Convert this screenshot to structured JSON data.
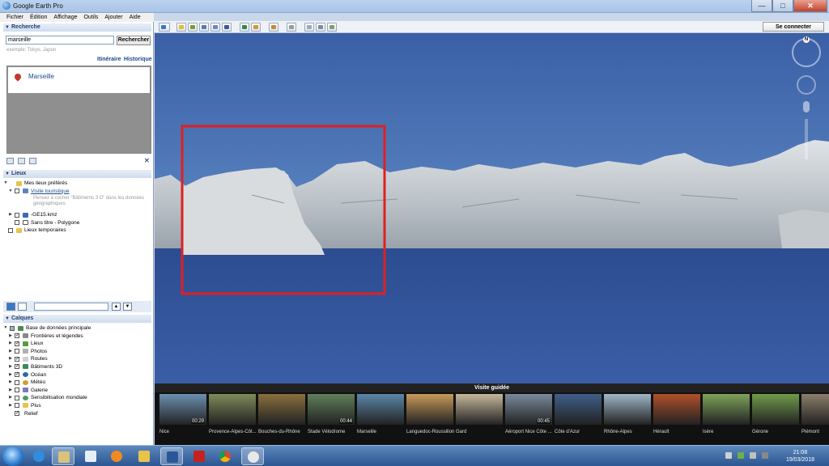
{
  "window": {
    "title": "Google Earth Pro",
    "minimize": "—",
    "maximize": "□",
    "close": "✕",
    "accent": "#2b6cb4"
  },
  "menu": [
    "Fichier",
    "Édition",
    "Affichage",
    "Outils",
    "Ajouter",
    "Aide"
  ],
  "toolbar": {
    "icons": [
      "sidebar-icon",
      "placemark-icon",
      "polygon-icon",
      "path-icon",
      "overlay-icon",
      "record-tour-icon",
      "historical-imagery-icon",
      "sun-icon",
      "planets-icon",
      "ruler-icon",
      "email-icon",
      "print-icon",
      "save-image-icon"
    ],
    "signin_label": "Se connecter"
  },
  "search": {
    "header": "Recherche",
    "input_value": "marseille",
    "button": "Rechercher",
    "hint": "exemple: Tokyo, Japon",
    "links": [
      "Itinéraire",
      "Historique"
    ],
    "results": [
      "Marseille"
    ]
  },
  "places": {
    "header": "Lieux",
    "items": [
      {
        "label": "Mes lieux préférés",
        "icon": "folder-icon"
      },
      {
        "label": "Visite touristique",
        "icon": "folder-icon",
        "description": "Pensez à cocher \"Bâtiments 3 D\" dans les données géographiques"
      },
      {
        "label": "-GE15.kmz",
        "icon": "kmz-icon"
      },
      {
        "label": "Sans titre - Polygone",
        "icon": "polygon-icon"
      },
      {
        "label": "Lieux temporaires",
        "icon": "folder-icon"
      }
    ]
  },
  "layers": {
    "header": "Calques",
    "root": "Base de données principale",
    "items": [
      {
        "label": "Frontières et légendes",
        "checked": true
      },
      {
        "label": "Lieux",
        "checked": true
      },
      {
        "label": "Photos",
        "checked": false
      },
      {
        "label": "Routes",
        "checked": true
      },
      {
        "label": "Bâtiments 3D",
        "checked": true
      },
      {
        "label": "Océan",
        "checked": true
      },
      {
        "label": "Météo",
        "checked": false
      },
      {
        "label": "Galerie",
        "checked": false
      },
      {
        "label": "Sensibilisation mondiale",
        "checked": false
      },
      {
        "label": "Plus",
        "checked": false
      },
      {
        "label": "Relief",
        "checked": true
      }
    ]
  },
  "map": {
    "sea_color": "#2e4f93",
    "sky_color": "#3c63ab",
    "highlight_color": "#e02020",
    "nav_north": "N"
  },
  "tour": {
    "header": "Visite guidée",
    "items": [
      {
        "label": "Nice",
        "duration": "00:29",
        "color": "#6d8fb0"
      },
      {
        "label": "Provence-Alpes-Côt...",
        "duration": "",
        "color": "#7e8b5a"
      },
      {
        "label": "Bouches-du-Rhône",
        "duration": "",
        "color": "#8a6f3e"
      },
      {
        "label": "Stade Vélodrome",
        "duration": "00:44",
        "color": "#5f7f5a"
      },
      {
        "label": "Marseille",
        "duration": "",
        "color": "#5a86a8"
      },
      {
        "label": "Languedoc-Roussillon",
        "duration": "",
        "color": "#c79a5a"
      },
      {
        "label": "Gard",
        "duration": "",
        "color": "#c6b79a"
      },
      {
        "label": "Aéroport Nice Côte ...",
        "duration": "00:45",
        "color": "#7a8a9c"
      },
      {
        "label": "Côte d'Azur",
        "duration": "",
        "color": "#3f5f88"
      },
      {
        "label": "Rhône-Alpes",
        "duration": "",
        "color": "#9fb6c8"
      },
      {
        "label": "Hérault",
        "duration": "",
        "color": "#b0502a"
      },
      {
        "label": "Isère",
        "duration": "",
        "color": "#7fa35a"
      },
      {
        "label": "Gérone",
        "duration": "",
        "color": "#6f9c4a"
      },
      {
        "label": "Piémont",
        "duration": "",
        "color": "#8a7f6a"
      }
    ]
  },
  "taskbar": {
    "apps": [
      "ie-icon",
      "explorer-icon",
      "notepad-icon",
      "media-player-icon",
      "folder-icon",
      "word-icon",
      "acrobat-icon",
      "chrome-icon",
      "google-earth-icon"
    ],
    "time": "21:08",
    "date": "19/03/2018"
  }
}
